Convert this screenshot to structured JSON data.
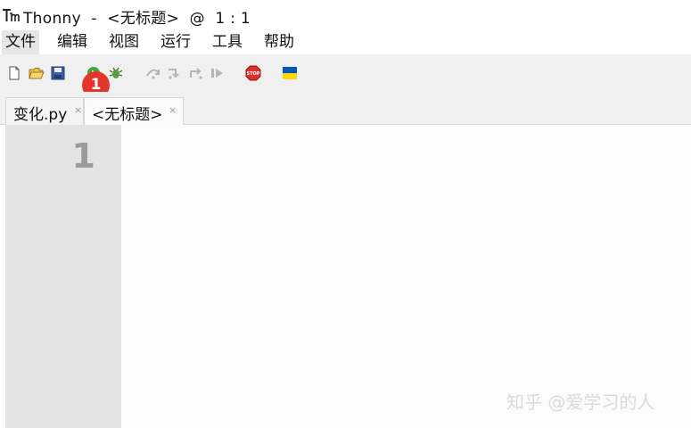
{
  "window": {
    "title": "Thonny  -  <无标题>  @  1 : 1"
  },
  "menu": {
    "items": [
      {
        "label": "文件"
      },
      {
        "label": "编辑"
      },
      {
        "label": "视图"
      },
      {
        "label": "运行"
      },
      {
        "label": "工具"
      },
      {
        "label": "帮助"
      }
    ]
  },
  "toolbar": {
    "buttons": [
      {
        "icon": "new-file-icon"
      },
      {
        "icon": "open-folder-icon"
      },
      {
        "icon": "save-icon"
      },
      {
        "icon": "run-icon"
      },
      {
        "icon": "debug-icon"
      },
      {
        "icon": "step-over-icon"
      },
      {
        "icon": "step-into-icon"
      },
      {
        "icon": "step-out-icon"
      },
      {
        "icon": "resume-icon"
      },
      {
        "icon": "stop-icon",
        "text": "STOP"
      },
      {
        "icon": "ukraine-flag-icon"
      }
    ],
    "annotation_badge": "1"
  },
  "tabs": [
    {
      "label": "变化.py",
      "close": "×"
    },
    {
      "label": "<无标题>",
      "close": "×",
      "active": true
    }
  ],
  "editor": {
    "line_numbers": [
      "1"
    ]
  },
  "watermark": {
    "text": "知乎 @爱学习的人"
  },
  "colors": {
    "badge": "#e5342b",
    "gutter": "#e3e3e3",
    "toolbar": "#f0f0f0",
    "flag_blue": "#0057b7",
    "flag_yellow": "#ffd700"
  }
}
